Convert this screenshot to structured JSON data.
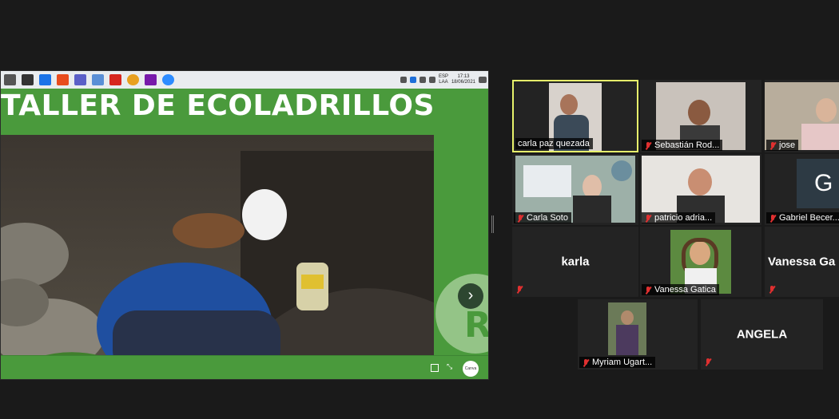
{
  "share": {
    "taskbar": {
      "apps": [
        {
          "icon": "window-icon",
          "color": "#555555"
        },
        {
          "icon": "store-icon",
          "color": "#333333"
        },
        {
          "icon": "mail-icon",
          "color": "#1a73e8"
        },
        {
          "icon": "office-icon",
          "color": "#e84c1e"
        },
        {
          "icon": "teams-icon",
          "color": "#5b5fc7"
        },
        {
          "icon": "explorer-icon",
          "color": "#5a8fd6"
        },
        {
          "icon": "acrobat-icon",
          "color": "#d7261e"
        },
        {
          "icon": "chrome-icon",
          "color": "#e8a020"
        },
        {
          "icon": "onenote-icon",
          "color": "#7719aa"
        },
        {
          "icon": "zoom-icon",
          "color": "#2d8cff"
        }
      ],
      "lang_top": "ESP",
      "lang_bottom": "LAA",
      "time": "17:13",
      "date": "18/06/2021"
    },
    "slide": {
      "title": "TALLER DE ECOLADRILLOS",
      "next_label": "›",
      "logo_letter": "R",
      "canva_label": "Canva",
      "accent": "#4a9a3c"
    }
  },
  "participants": [
    {
      "name": "carla paz quezada",
      "muted": false,
      "active": true,
      "has_video": true
    },
    {
      "name": "Sebastián Rod...",
      "muted": true,
      "active": false,
      "has_video": true
    },
    {
      "name": "jose",
      "muted": true,
      "active": false,
      "has_video": true
    },
    {
      "name": "Carla Soto",
      "muted": true,
      "active": false,
      "has_video": true
    },
    {
      "name": "patricio adria...",
      "muted": true,
      "active": false,
      "has_video": true
    },
    {
      "name": "Gabriel Becer...",
      "muted": true,
      "active": false,
      "has_video": false,
      "initial": "G"
    },
    {
      "name": "karla",
      "muted": true,
      "active": false,
      "has_video": false,
      "label": "karla"
    },
    {
      "name": "Vanessa Gatica",
      "muted": true,
      "active": false,
      "has_video": true
    },
    {
      "name": "Vanessa Ga",
      "muted": true,
      "active": false,
      "has_video": false,
      "label": "Vanessa  Ga"
    },
    {
      "name": "Myriam Ugart...",
      "muted": true,
      "active": false,
      "has_video": true
    },
    {
      "name": "ANGELA",
      "muted": true,
      "active": false,
      "has_video": false,
      "label": "ANGELA"
    }
  ]
}
